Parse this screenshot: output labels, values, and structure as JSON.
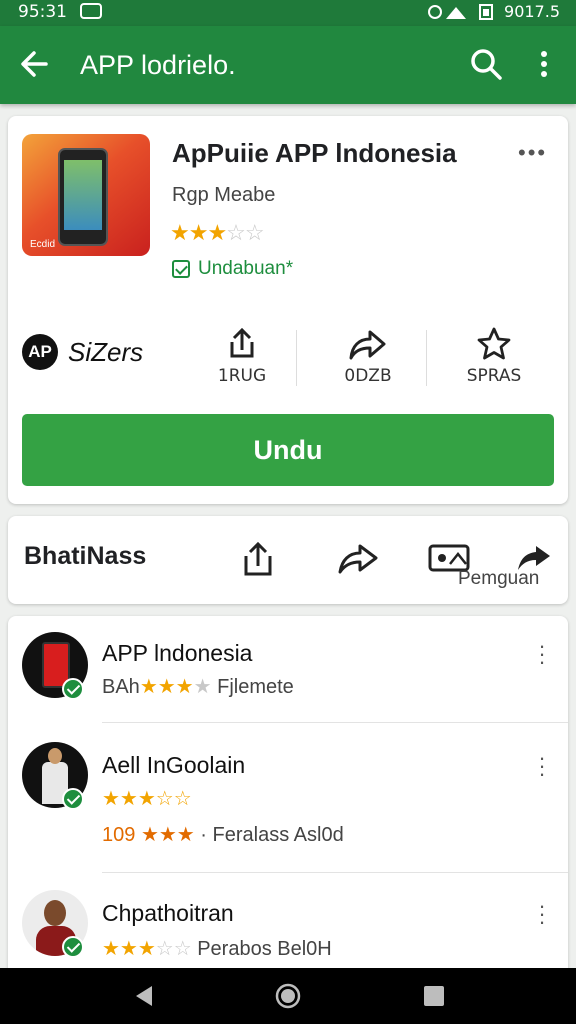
{
  "status_bar": {
    "time": "95:31",
    "battery": "9017.5"
  },
  "app_bar": {
    "title": "APP lodrielo.",
    "icons": [
      "back-arrow-icon",
      "search-icon",
      "more-vert-icon"
    ]
  },
  "app": {
    "title": "ApPuiie APP lndonesia",
    "developer": "Rgp Meabe",
    "rating": 3,
    "installed_label": "Undabuan*",
    "icon_caption": "Ecdid",
    "brand_logo": "AP",
    "brand_name": "SiZers",
    "stats": [
      {
        "icon": "share-up-icon",
        "label": "1RUG"
      },
      {
        "icon": "forward-icon",
        "label": "0DZB"
      },
      {
        "icon": "star-outline-icon",
        "label": "SPRAS"
      }
    ],
    "install_button": "Undu"
  },
  "actions": {
    "title": "BhatiNass",
    "caption": "Pemguan",
    "icons": [
      "share-up-icon",
      "forward-icon",
      "image-card-icon",
      "share-arrow-icon"
    ]
  },
  "list": [
    {
      "name": "APP lndonesia",
      "meta_prefix": "BAh",
      "stars": "★★★",
      "stars_off": "",
      "meta_suffix": "Fjlemete"
    },
    {
      "name": "Aell InGoolain",
      "stars_line": "★★★☆☆",
      "meta_prefix": "109",
      "stars": "★★★",
      "meta_suffix": "· Feralass Asl0d"
    },
    {
      "name": "Chpathoitran",
      "stars": "★★★",
      "stars_off": "☆☆",
      "meta_suffix": "Perabos  Bel0H"
    }
  ],
  "colors": {
    "app_bar": "#21883f",
    "status_bar": "#1f7a3a",
    "install": "#34a244",
    "star": "#f2a400"
  }
}
